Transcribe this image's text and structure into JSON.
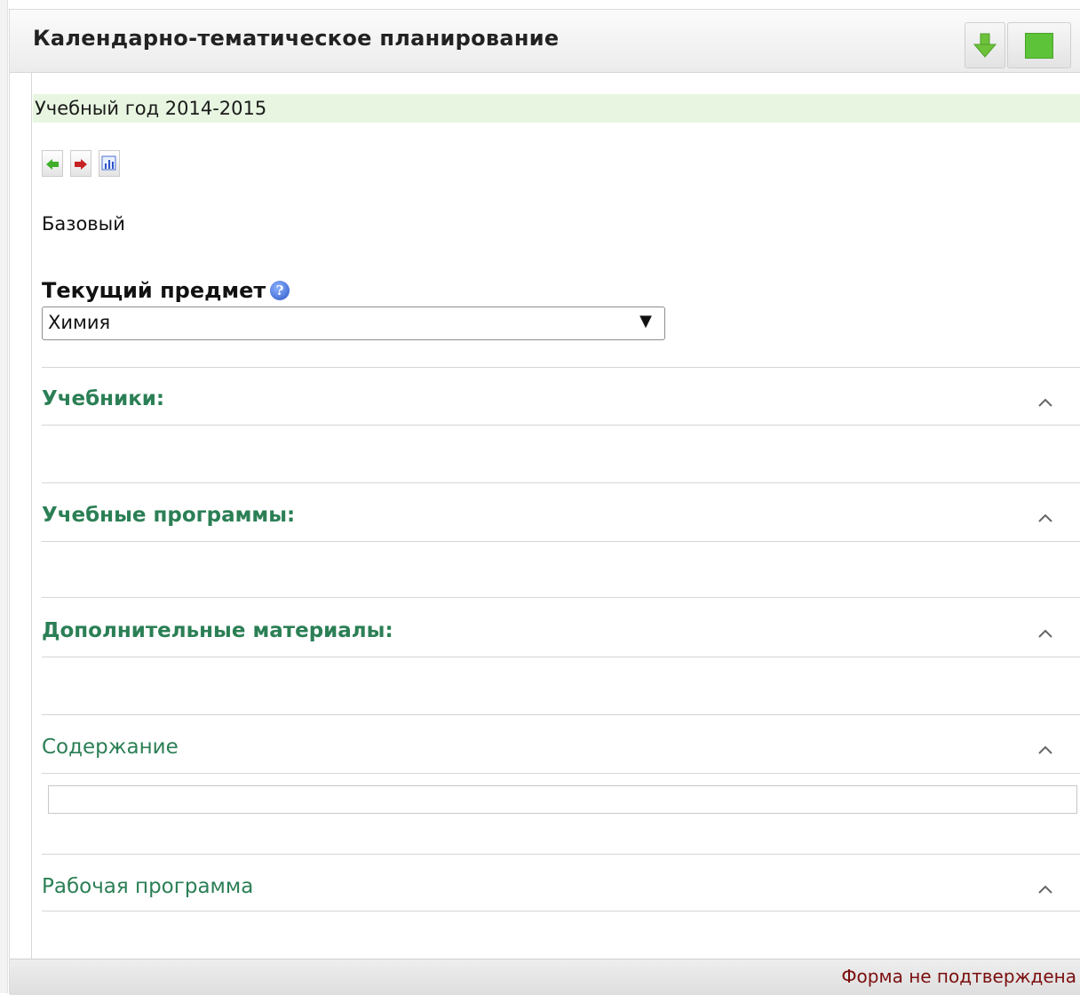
{
  "header": {
    "title": "Календарно-тематическое планирование",
    "actions": [
      {
        "name": "download",
        "icon": "green-down-arrow-icon",
        "color": "#6cc33a"
      },
      {
        "name": "confirm",
        "icon": "green-square-icon",
        "color": "#5dc338"
      }
    ]
  },
  "year_bar": {
    "text": "Учебный год 2014-2015",
    "background": "#e8f6e1"
  },
  "toolbar_icons": [
    "import-icon",
    "export-icon",
    "report-chart-icon"
  ],
  "level_text": "Базовый",
  "subject": {
    "label": "Текущий предмет",
    "help_icon": "help-icon",
    "selected": "Химия",
    "arrow": "▼"
  },
  "sections": [
    {
      "title": "Учебники:"
    },
    {
      "title": "Учебные программы:"
    },
    {
      "title": "Дополнительные материалы:"
    },
    {
      "title": "Содержание"
    },
    {
      "title": "Рабочая программа"
    }
  ],
  "accent_color": "#2b7f55",
  "footer": {
    "status": "Форма не подтверждена",
    "status_color": "#7b0f0f"
  }
}
